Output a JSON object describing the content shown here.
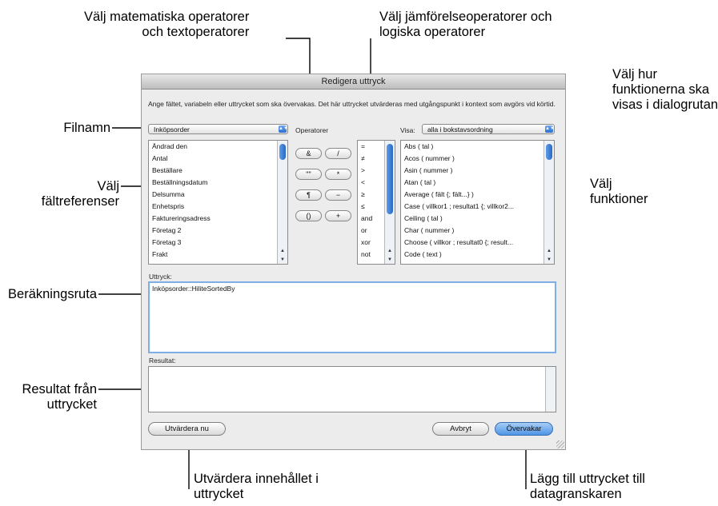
{
  "callouts": {
    "math_ops": "Välj matematiska operatorer\noch textoperatorer",
    "compare_ops": "Välj jämförelseoperatorer och\nlogiska operatorer",
    "func_view": "Välj hur\nfunktionerna ska\nvisas i dialogrutan",
    "filename": "Filnamn",
    "field_refs": "Välj\nfältreferenser",
    "functions": "Välj\nfunktioner",
    "calc_box": "Beräkningsruta",
    "result": "Resultat från\nuttrycket",
    "evaluate": "Utvärdera innehållet i\nuttrycket",
    "add_watch": "Lägg till uttrycket till\ndatagranskaren"
  },
  "dialog": {
    "title": "Redigera uttryck",
    "instructions": "Ange fältet, variabeln eller uttrycket som ska övervakas. Det här uttrycket utvärderas med utgångspunkt i kontext som avgörs vid körtid.",
    "table_popup": "Inköpsorder",
    "operators_label": "Operatorer",
    "view_label": "Visa:",
    "view_popup": "alla i bokstavsordning",
    "fields": [
      "Ändrad den",
      "Antal",
      "Beställare",
      "Beställningsdatum",
      "Delsumma",
      "Enhetspris",
      "Faktureringsadress",
      "Företag 2",
      "Företag 3",
      "Frakt"
    ],
    "math_operators": [
      "&",
      "/",
      "\"\"",
      "*",
      "¶",
      "−",
      "()",
      "+"
    ],
    "compare_operators": [
      "=",
      "≠",
      ">",
      "<",
      "≥",
      "≤",
      "and",
      "or",
      "xor",
      "not"
    ],
    "functions": [
      "Abs ( tal )",
      "Acos ( nummer )",
      "Asin ( nummer )",
      "Atan ( tal )",
      "Average ( fält {; fält...} )",
      "Case ( villkor1 ; resultat1 {; villkor2...",
      "Ceiling ( tal )",
      "Char ( nummer )",
      "Choose ( villkor ; resultat0 {; result...",
      "Code ( text )"
    ],
    "expression_label": "Uttryck:",
    "expression_value": "Inköpsorder::HiliteSortedBy",
    "result_label": "Resultat:",
    "result_value": "",
    "evaluate_button": "Utvärdera nu",
    "cancel_button": "Avbryt",
    "monitor_button": "Övervakar"
  }
}
